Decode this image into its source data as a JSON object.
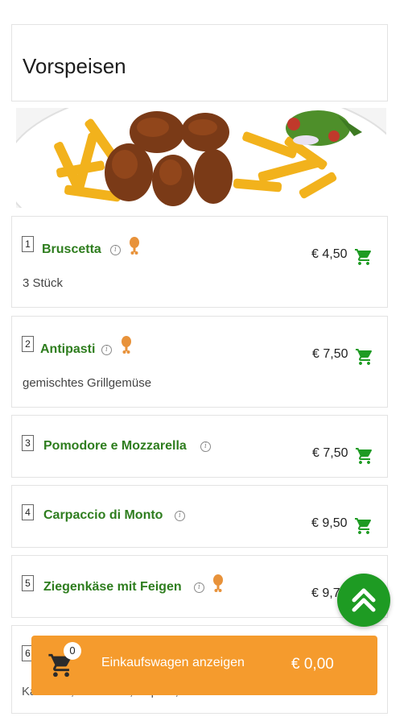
{
  "section": {
    "title": "Vorspeisen"
  },
  "items": [
    {
      "number": "1",
      "name": "Bruscetta",
      "description": "3 Stück",
      "price": "€ 4,50"
    },
    {
      "number": "2",
      "name": "Antipasti",
      "description": "gemischtes Grillgemüse",
      "price": "€ 7,50"
    },
    {
      "number": "3",
      "name": "Pomodore e Mozzarella",
      "price": "€ 7,50"
    },
    {
      "number": "4",
      "name": "Carpaccio di Monto",
      "price": "€ 9,50"
    },
    {
      "number": "5",
      "name": "Ziegenkäse mit Feigen",
      "price": "€ 9,7"
    },
    {
      "number": "6",
      "description": "Kalbsfilet, Thunfisch, Kapern, Sauce"
    }
  ],
  "cart": {
    "count": "0",
    "label": "Einkaufswagen anzeigen",
    "total": "€ 0,00"
  },
  "colors": {
    "accent_green": "#2e7d1e",
    "fab_green": "#1e9b23",
    "cart_orange": "#f59b2d"
  },
  "icons": {
    "info": "info-icon",
    "allergen": "drumstick-icon",
    "cart": "shopping-cart-icon",
    "scroll": "double-chevron-up-icon"
  }
}
